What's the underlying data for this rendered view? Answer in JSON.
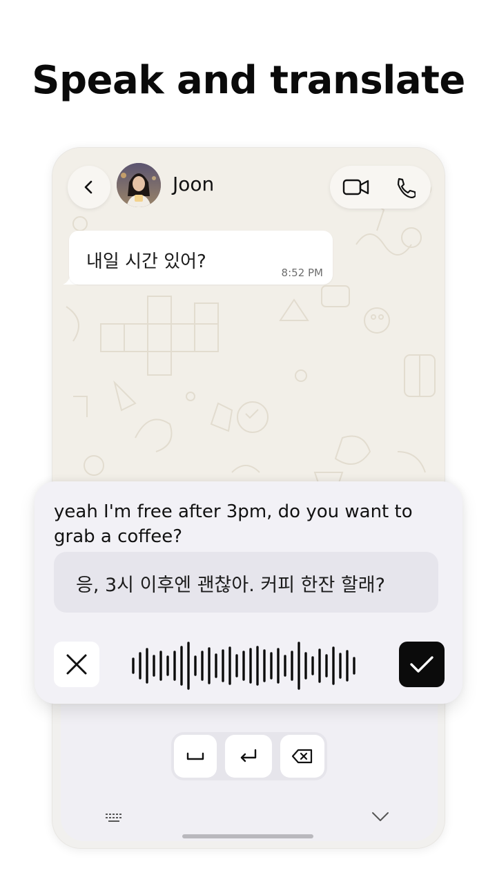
{
  "headline": "Speak and translate",
  "header": {
    "contact_name": "Joon",
    "back_icon": "chevron-left-icon",
    "video_icon": "video-camera-icon",
    "phone_icon": "phone-icon"
  },
  "message": {
    "text": "내일 시간 있어?",
    "time": "8:52 PM"
  },
  "voice_panel": {
    "spoken_text": "yeah I'm free after 3pm, do you want to grab a coffee?",
    "translated_text": "응, 3시 이후엔 괜찮아. 커피 한잔 할래?",
    "cancel_icon": "close-icon",
    "confirm_icon": "check-icon"
  },
  "keyboard": {
    "keys": [
      "space-icon",
      "enter-icon",
      "backspace-icon"
    ],
    "keyboard_icon": "keyboard-icon",
    "collapse_icon": "chevron-down-icon"
  },
  "colors": {
    "chat_bg": "#f2efe8",
    "panel_bg": "#f2f1f6",
    "confirm_bg": "#0b0b0b"
  }
}
